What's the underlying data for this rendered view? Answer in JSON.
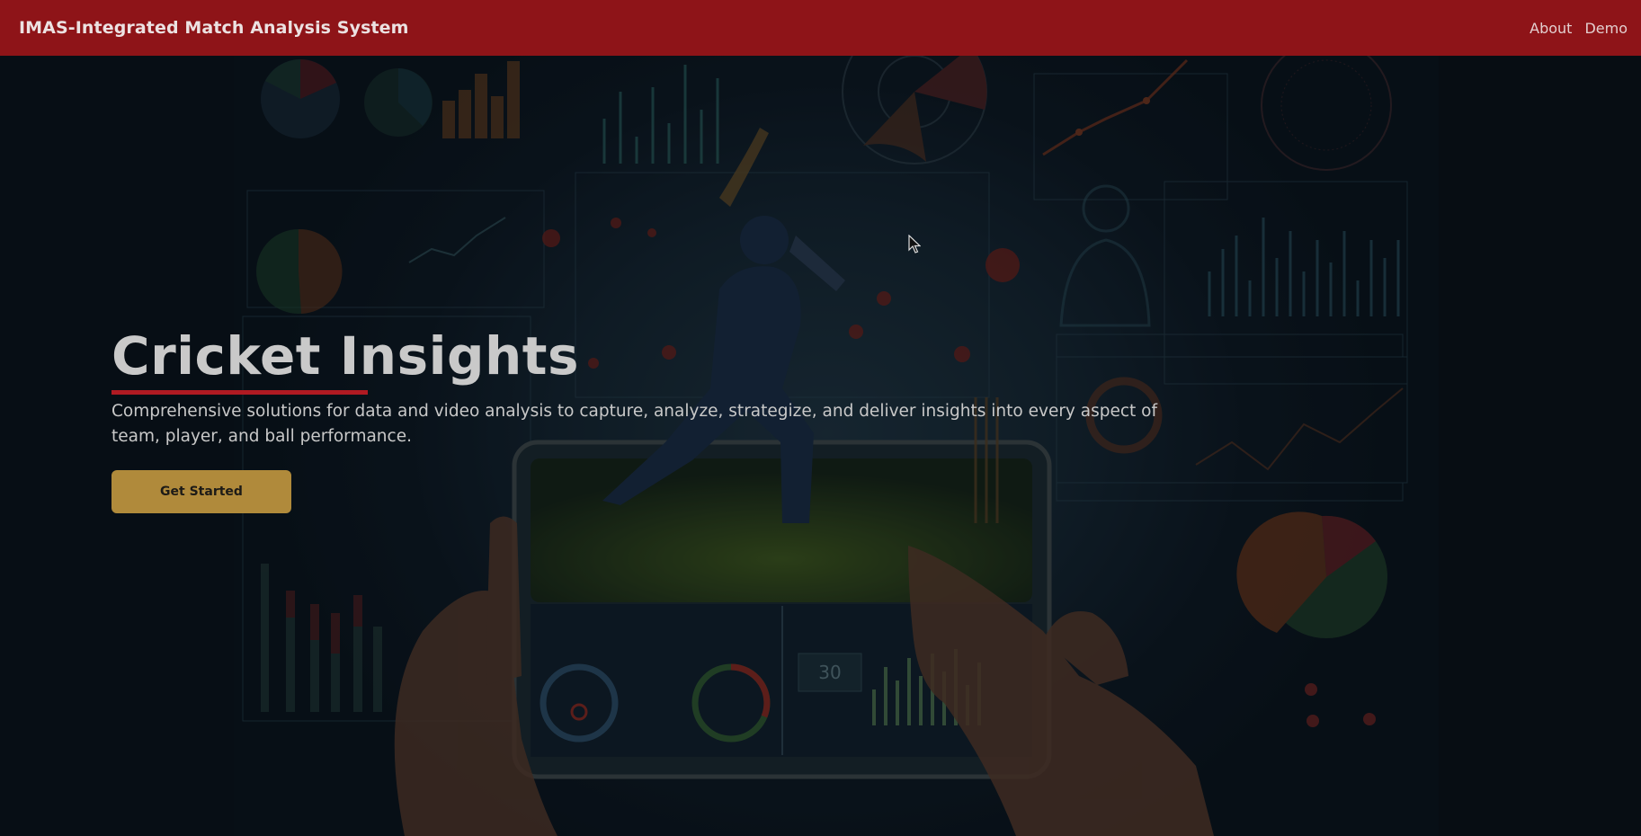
{
  "header": {
    "brand": "IMAS-Integrated Match Analysis System",
    "nav": [
      {
        "label": "About"
      },
      {
        "label": "Demo"
      }
    ]
  },
  "hero": {
    "title": "Cricket Insights",
    "description": "Comprehensive solutions for data and video analysis to capture, analyze, strategize, and deliver insights into every aspect of team, player, and ball performance.",
    "cta_label": "Get Started",
    "screen_counter": "30"
  },
  "colors": {
    "navbar": "#8e1418",
    "accent_underline": "#b01a22",
    "cta": "#b08a3b",
    "background": "#0b141c"
  },
  "icons": {
    "cursor": "mouse-pointer-icon"
  }
}
